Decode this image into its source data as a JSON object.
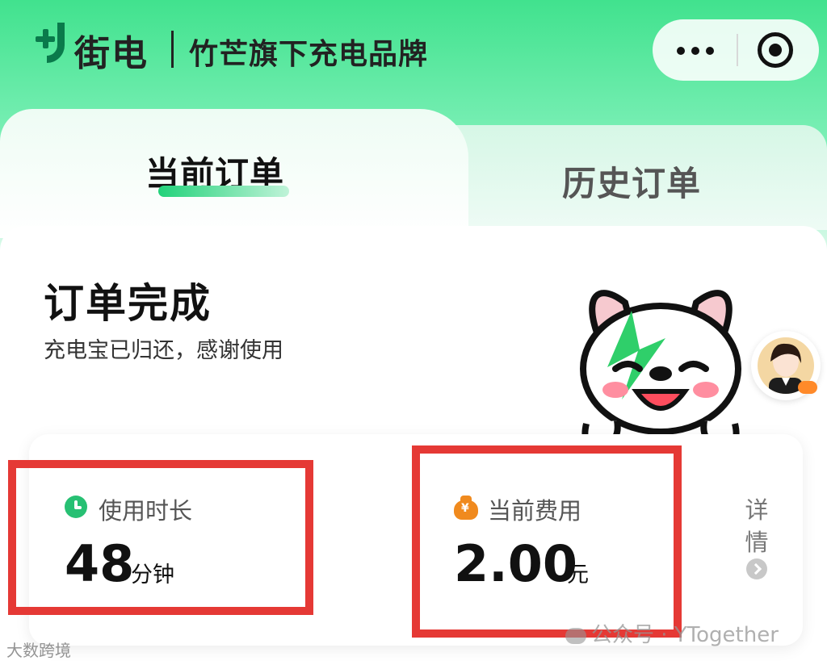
{
  "header": {
    "brand_name": "街电",
    "brand_tagline": "竹芒旗下充电品牌"
  },
  "tabs": [
    {
      "label": "当前订单",
      "active": true
    },
    {
      "label": "历史订单",
      "active": false
    }
  ],
  "order_status": {
    "title": "订单完成",
    "subtitle": "充电宝已归还，感谢使用"
  },
  "metrics": {
    "duration": {
      "label": "使用时长",
      "value": "48",
      "unit": "分钟",
      "icon": "clock-icon"
    },
    "fee": {
      "label": "当前费用",
      "value": "2.00",
      "unit": "元",
      "icon": "money-bag-icon"
    },
    "detail_label": "详情"
  },
  "watermarks": {
    "left": "大数跨境",
    "right": "公众号 · YTogether"
  },
  "colors": {
    "brand_green": "#0a7a4b",
    "accent_green": "#22d27a",
    "highlight_red": "#e53935",
    "fee_icon_orange": "#f08a1e"
  }
}
